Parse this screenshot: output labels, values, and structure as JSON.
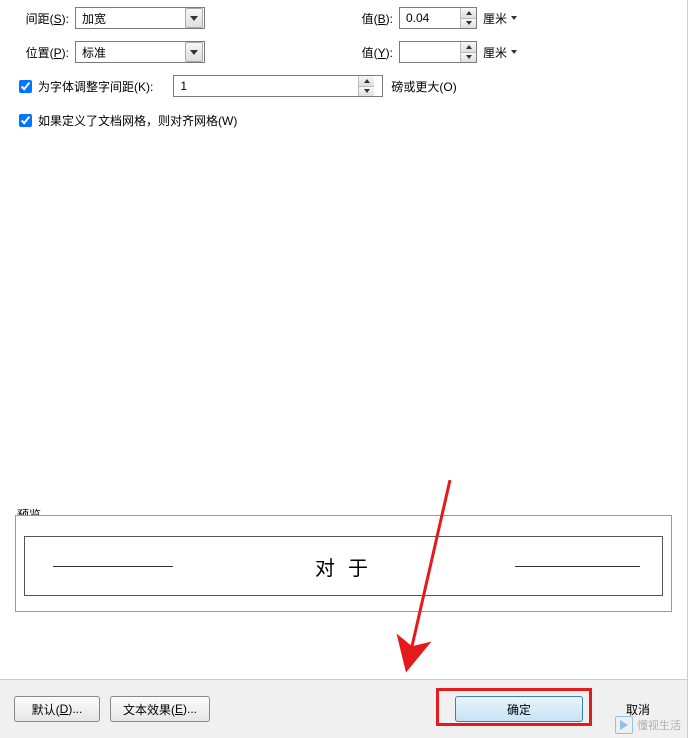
{
  "fields": {
    "spacing_label_pre": "间距(",
    "spacing_label_key": "S",
    "spacing_label_post": "):",
    "spacing_value": "加宽",
    "position_label_pre": "位置(",
    "position_label_key": "P",
    "position_label_post": "):",
    "position_value": "标准",
    "value_b_label_pre": "值(",
    "value_b_label_key": "B",
    "value_b_label_post": "):",
    "value_b": "0.04",
    "value_y_label_pre": "值(",
    "value_y_label_key": "Y",
    "value_y_label_post": "):",
    "value_y": "",
    "unit": "厘米",
    "kerning_label_pre": "为字体调整字间距(",
    "kerning_label_key": "K",
    "kerning_label_post": "):",
    "kerning_value": "1",
    "kerning_unit_pre": "磅或更大(",
    "kerning_unit_key": "O",
    "kerning_unit_post": ")",
    "grid_label_pre": "如果定义了文档网格，则对齐网格(",
    "grid_label_key": "W",
    "grid_label_post": ")"
  },
  "preview": {
    "label": "预览",
    "text": "对 于"
  },
  "buttons": {
    "default_pre": "默认(",
    "default_key": "D",
    "default_post": ")...",
    "effects_pre": "文本效果(",
    "effects_key": "E",
    "effects_post": ")...",
    "ok": "确定",
    "cancel": "取消"
  },
  "watermark": "懂视生活"
}
